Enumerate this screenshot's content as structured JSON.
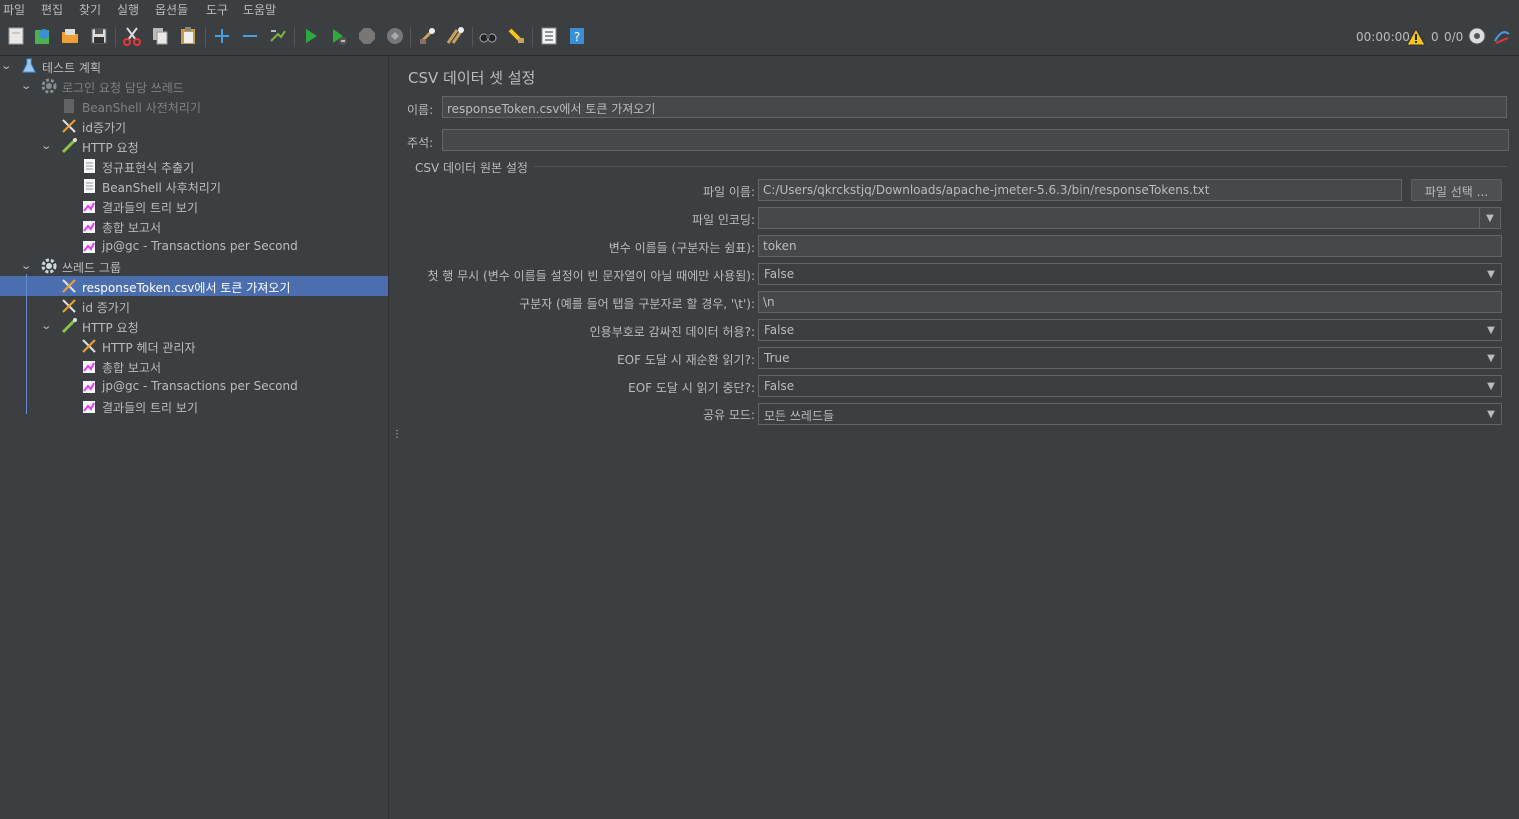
{
  "menu": [
    "파일",
    "편집",
    "찾기",
    "실행",
    "옵션들",
    "도구",
    "도움말"
  ],
  "toolbar": {
    "timer": "00:00:00",
    "warning_count": "0",
    "threads": "0/0"
  },
  "tree": [
    {
      "label": "테스트 계획",
      "level": 0,
      "expander": "v",
      "icon": "test-plan-icon",
      "state": "normal"
    },
    {
      "label": "로그인 요청 담당 쓰레드",
      "level": 1,
      "expander": "v",
      "icon": "gear-icon",
      "state": "disabled"
    },
    {
      "label": "BeanShell 사전처리기",
      "level": 2,
      "expander": "",
      "icon": "preprocessor-icon",
      "state": "disabled"
    },
    {
      "label": "id증가기",
      "level": 2,
      "expander": "",
      "icon": "config-tools-icon",
      "state": "normal"
    },
    {
      "label": "HTTP 요청",
      "level": 2,
      "expander": "v",
      "icon": "sampler-pen-icon",
      "state": "normal"
    },
    {
      "label": "정규표현식 추출기",
      "level": 3,
      "expander": "",
      "icon": "document-icon",
      "state": "normal"
    },
    {
      "label": "BeanShell 사후처리기",
      "level": 3,
      "expander": "",
      "icon": "document-icon",
      "state": "normal"
    },
    {
      "label": "결과들의 트리 보기",
      "level": 3,
      "expander": "",
      "icon": "listener-chart-icon",
      "state": "normal"
    },
    {
      "label": "총합 보고서",
      "level": 3,
      "expander": "",
      "icon": "listener-chart-icon",
      "state": "normal"
    },
    {
      "label": "jp@gc - Transactions per Second",
      "level": 3,
      "expander": "",
      "icon": "listener-chart-icon",
      "state": "normal"
    },
    {
      "label": "쓰레드 그룹",
      "level": 1,
      "expander": "v",
      "icon": "gear-icon",
      "state": "normal"
    },
    {
      "label": "responseToken.csv에서 토큰 가져오기",
      "level": 2,
      "expander": "",
      "icon": "config-tools-icon",
      "state": "selected"
    },
    {
      "label": "id 증가기",
      "level": 2,
      "expander": "",
      "icon": "config-tools-icon",
      "state": "normal"
    },
    {
      "label": "HTTP 요청",
      "level": 2,
      "expander": "v",
      "icon": "sampler-pen-icon",
      "state": "normal"
    },
    {
      "label": "HTTP 헤더 관리자",
      "level": 3,
      "expander": "",
      "icon": "config-tools-icon",
      "state": "normal"
    },
    {
      "label": "총합 보고서",
      "level": 3,
      "expander": "",
      "icon": "listener-chart-icon",
      "state": "normal"
    },
    {
      "label": "jp@gc - Transactions per Second",
      "level": 3,
      "expander": "",
      "icon": "listener-chart-icon",
      "state": "normal"
    },
    {
      "label": "결과들의 트리 보기",
      "level": 3,
      "expander": "",
      "icon": "listener-chart-icon",
      "state": "normal"
    }
  ],
  "panel": {
    "title": "CSV 데이터 셋 설정",
    "name_label": "이름:",
    "name_value": "responseToken.csv에서 토큰 가져오기",
    "comment_label": "주석:",
    "comment_value": "",
    "group_title": "CSV 데이터 원본 설정",
    "filename_label": "파일 이름:",
    "filename_value": "C:/Users/qkrckstjq/Downloads/apache-jmeter-5.6.3/bin/responseTokens.txt",
    "browse_button": "파일 선택 ...",
    "encoding_label": "파일 인코딩:",
    "encoding_value": "",
    "varnames_label": "변수 이름들 (구분자는 쉼표):",
    "varnames_value": "token",
    "ignore_first_label": "첫 행 무시 (변수 이름들 설정이 빈 문자열이 아닐 때에만 사용됨):",
    "ignore_first_value": "False",
    "delimiter_label": "구분자 (예를 들어 탭을 구분자로 할 경우, '\\t'):",
    "delimiter_value": "\\n",
    "quoted_label": "인용부호로 감싸진 데이터 허용?:",
    "quoted_value": "False",
    "recycle_label": "EOF 도달 시 재순환 읽기?:",
    "recycle_value": "True",
    "stop_label": "EOF 도달 시 읽기 중단?:",
    "stop_value": "False",
    "share_label": "공유 모드:",
    "share_value": "모든 쓰레드들"
  }
}
